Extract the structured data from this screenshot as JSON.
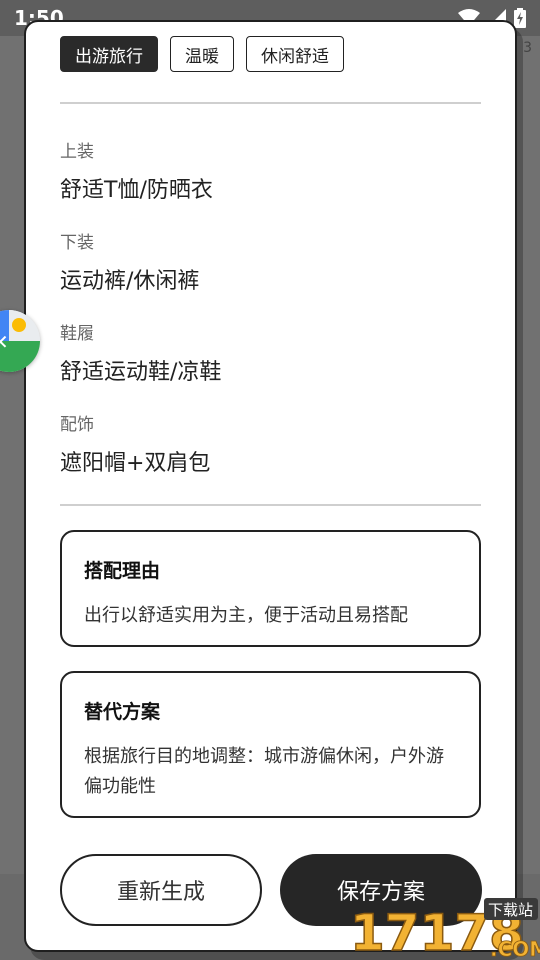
{
  "status_bar": {
    "time": "1:50"
  },
  "background": {
    "corner_text": "3"
  },
  "chips": [
    {
      "label": "出游旅行",
      "active": true
    },
    {
      "label": "温暖",
      "active": false
    },
    {
      "label": "休闲舒适",
      "active": false
    }
  ],
  "outfit": {
    "top": {
      "label": "上装",
      "value": "舒适T恤/防晒衣"
    },
    "bottom": {
      "label": "下装",
      "value": "运动裤/休闲裤"
    },
    "shoes": {
      "label": "鞋履",
      "value": "舒适运动鞋/凉鞋"
    },
    "accessories": {
      "label": "配饰",
      "value": "遮阳帽+双肩包"
    }
  },
  "reason_card": {
    "title": "搭配理由",
    "body": "出行以舒适实用为主，便于活动且易搭配"
  },
  "alternative_card": {
    "title": "替代方案",
    "body": "根据旅行目的地调整：城市游偏休闲，户外游偏功能性"
  },
  "actions": {
    "regenerate": "重新生成",
    "save": "保存方案"
  },
  "watermark": {
    "text": "17178",
    "suffix": ".COM",
    "badge": "下载站"
  }
}
